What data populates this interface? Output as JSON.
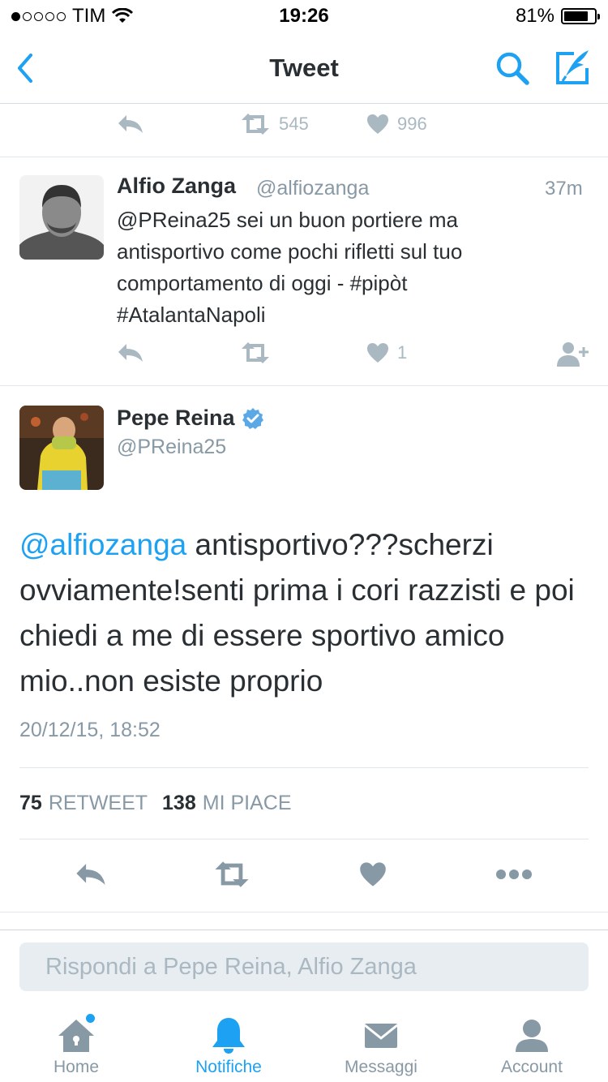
{
  "status_bar": {
    "carrier": "TIM",
    "time": "19:26",
    "battery": "81%",
    "battery_level": 0.81
  },
  "nav": {
    "title": "Tweet"
  },
  "previous_actions": {
    "retweet_count": "545",
    "like_count": "996"
  },
  "reply_tweet": {
    "name": "Alfio Zanga",
    "handle": "@alfiozanga",
    "time": "37m",
    "text_lines": [
      "@PReina25 sei un buon portiere ma",
      "antisportivo come pochi rifletti sul tuo",
      "comportamento di oggi - #pipòt",
      "#AtalantaNapoli"
    ],
    "like_count": "1"
  },
  "main_tweet": {
    "name": "Pepe Reina",
    "handle": "@PReina25",
    "mention": "@alfiozanga",
    "text_first": " antisportivo???scherzi",
    "text_rest": "ovviamente!senti prima i cori razzisti e poi chiedi a me di essere sportivo amico mio..non esiste proprio",
    "date": "20/12/15, 18:52",
    "retweets": "75",
    "retweets_label": "RETWEET",
    "likes": "138",
    "likes_label": "MI PIACE"
  },
  "reply_box": {
    "placeholder": "Rispondi a Pepe Reina, Alfio Zanga"
  },
  "tabs": [
    {
      "label": "Home",
      "icon": "home-icon"
    },
    {
      "label": "Notifiche",
      "icon": "bell-icon"
    },
    {
      "label": "Messaggi",
      "icon": "envelope-icon"
    },
    {
      "label": "Account",
      "icon": "person-icon"
    }
  ],
  "colors": {
    "accent": "#1da1f2",
    "muted": "#aab8c2",
    "text": "#292f33"
  }
}
